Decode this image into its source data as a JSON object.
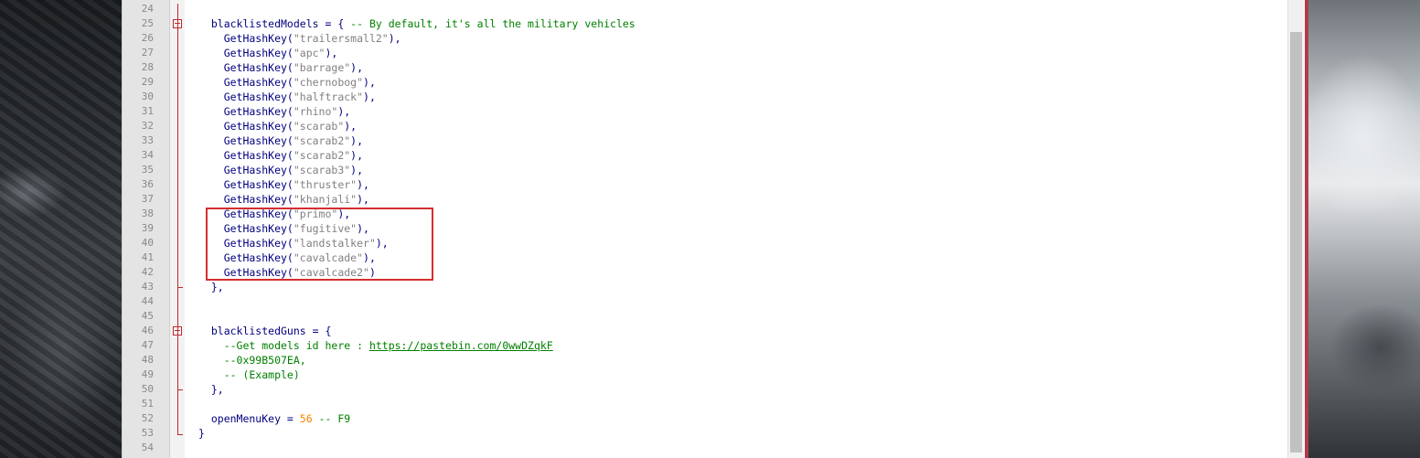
{
  "editor": {
    "lines": [
      {
        "num": "24",
        "segments": []
      },
      {
        "num": "25",
        "segments": [
          {
            "t": "  blacklistedModels = { ",
            "c": ""
          },
          {
            "t": "-- By default, it's all the military vehicles",
            "c": "cmt"
          }
        ]
      },
      {
        "num": "26",
        "segments": [
          {
            "t": "    GetHashKey(",
            "c": ""
          },
          {
            "t": "\"trailersmall2\"",
            "c": "str"
          },
          {
            "t": "),",
            "c": ""
          }
        ]
      },
      {
        "num": "27",
        "segments": [
          {
            "t": "    GetHashKey(",
            "c": ""
          },
          {
            "t": "\"apc\"",
            "c": "str"
          },
          {
            "t": "),",
            "c": ""
          }
        ]
      },
      {
        "num": "28",
        "segments": [
          {
            "t": "    GetHashKey(",
            "c": ""
          },
          {
            "t": "\"barrage\"",
            "c": "str"
          },
          {
            "t": "),",
            "c": ""
          }
        ]
      },
      {
        "num": "29",
        "segments": [
          {
            "t": "    GetHashKey(",
            "c": ""
          },
          {
            "t": "\"chernobog\"",
            "c": "str"
          },
          {
            "t": "),",
            "c": ""
          }
        ]
      },
      {
        "num": "30",
        "segments": [
          {
            "t": "    GetHashKey(",
            "c": ""
          },
          {
            "t": "\"halftrack\"",
            "c": "str"
          },
          {
            "t": "),",
            "c": ""
          }
        ]
      },
      {
        "num": "31",
        "segments": [
          {
            "t": "    GetHashKey(",
            "c": ""
          },
          {
            "t": "\"rhino\"",
            "c": "str"
          },
          {
            "t": "),",
            "c": ""
          }
        ]
      },
      {
        "num": "32",
        "segments": [
          {
            "t": "    GetHashKey(",
            "c": ""
          },
          {
            "t": "\"scarab\"",
            "c": "str"
          },
          {
            "t": "),",
            "c": ""
          }
        ]
      },
      {
        "num": "33",
        "segments": [
          {
            "t": "    GetHashKey(",
            "c": ""
          },
          {
            "t": "\"scarab2\"",
            "c": "str"
          },
          {
            "t": "),",
            "c": ""
          }
        ]
      },
      {
        "num": "34",
        "segments": [
          {
            "t": "    GetHashKey(",
            "c": ""
          },
          {
            "t": "\"scarab2\"",
            "c": "str"
          },
          {
            "t": "),",
            "c": ""
          }
        ]
      },
      {
        "num": "35",
        "segments": [
          {
            "t": "    GetHashKey(",
            "c": ""
          },
          {
            "t": "\"scarab3\"",
            "c": "str"
          },
          {
            "t": "),",
            "c": ""
          }
        ]
      },
      {
        "num": "36",
        "segments": [
          {
            "t": "    GetHashKey(",
            "c": ""
          },
          {
            "t": "\"thruster\"",
            "c": "str"
          },
          {
            "t": "),",
            "c": ""
          }
        ]
      },
      {
        "num": "37",
        "segments": [
          {
            "t": "    GetHashKey(",
            "c": ""
          },
          {
            "t": "\"khanjali\"",
            "c": "str"
          },
          {
            "t": "),",
            "c": ""
          }
        ]
      },
      {
        "num": "38",
        "segments": [
          {
            "t": "    GetHashKey(",
            "c": ""
          },
          {
            "t": "\"primo\"",
            "c": "str"
          },
          {
            "t": "),",
            "c": ""
          }
        ]
      },
      {
        "num": "39",
        "segments": [
          {
            "t": "    GetHashKey(",
            "c": ""
          },
          {
            "t": "\"fugitive\"",
            "c": "str"
          },
          {
            "t": "),",
            "c": ""
          }
        ]
      },
      {
        "num": "40",
        "segments": [
          {
            "t": "    GetHashKey(",
            "c": ""
          },
          {
            "t": "\"landstalker\"",
            "c": "str"
          },
          {
            "t": "),",
            "c": ""
          }
        ]
      },
      {
        "num": "41",
        "segments": [
          {
            "t": "    GetHashKey(",
            "c": ""
          },
          {
            "t": "\"cavalcade\"",
            "c": "str"
          },
          {
            "t": "),",
            "c": ""
          }
        ]
      },
      {
        "num": "42",
        "segments": [
          {
            "t": "    GetHashKey(",
            "c": ""
          },
          {
            "t": "\"cavalcade2\"",
            "c": "str"
          },
          {
            "t": ")",
            "c": ""
          }
        ]
      },
      {
        "num": "43",
        "segments": [
          {
            "t": "  },",
            "c": ""
          }
        ]
      },
      {
        "num": "44",
        "segments": []
      },
      {
        "num": "45",
        "segments": []
      },
      {
        "num": "46",
        "segments": [
          {
            "t": "  blacklistedGuns = {",
            "c": ""
          }
        ]
      },
      {
        "num": "47",
        "segments": [
          {
            "t": "    --Get models id here : ",
            "c": "cmt"
          },
          {
            "t": "https://pastebin.com/0wwDZqkF",
            "c": "link"
          }
        ]
      },
      {
        "num": "48",
        "segments": [
          {
            "t": "    --0x99B507EA,",
            "c": "cmt"
          }
        ]
      },
      {
        "num": "49",
        "segments": [
          {
            "t": "    -- (Example)",
            "c": "cmt"
          }
        ]
      },
      {
        "num": "50",
        "segments": [
          {
            "t": "  },",
            "c": ""
          }
        ]
      },
      {
        "num": "51",
        "segments": []
      },
      {
        "num": "52",
        "segments": [
          {
            "t": "  openMenuKey = ",
            "c": ""
          },
          {
            "t": "56",
            "c": "num"
          },
          {
            "t": " ",
            "c": ""
          },
          {
            "t": "-- F9",
            "c": "cmt"
          }
        ]
      },
      {
        "num": "53",
        "segments": [
          {
            "t": "}",
            "c": ""
          }
        ]
      },
      {
        "num": "54",
        "segments": []
      }
    ]
  }
}
